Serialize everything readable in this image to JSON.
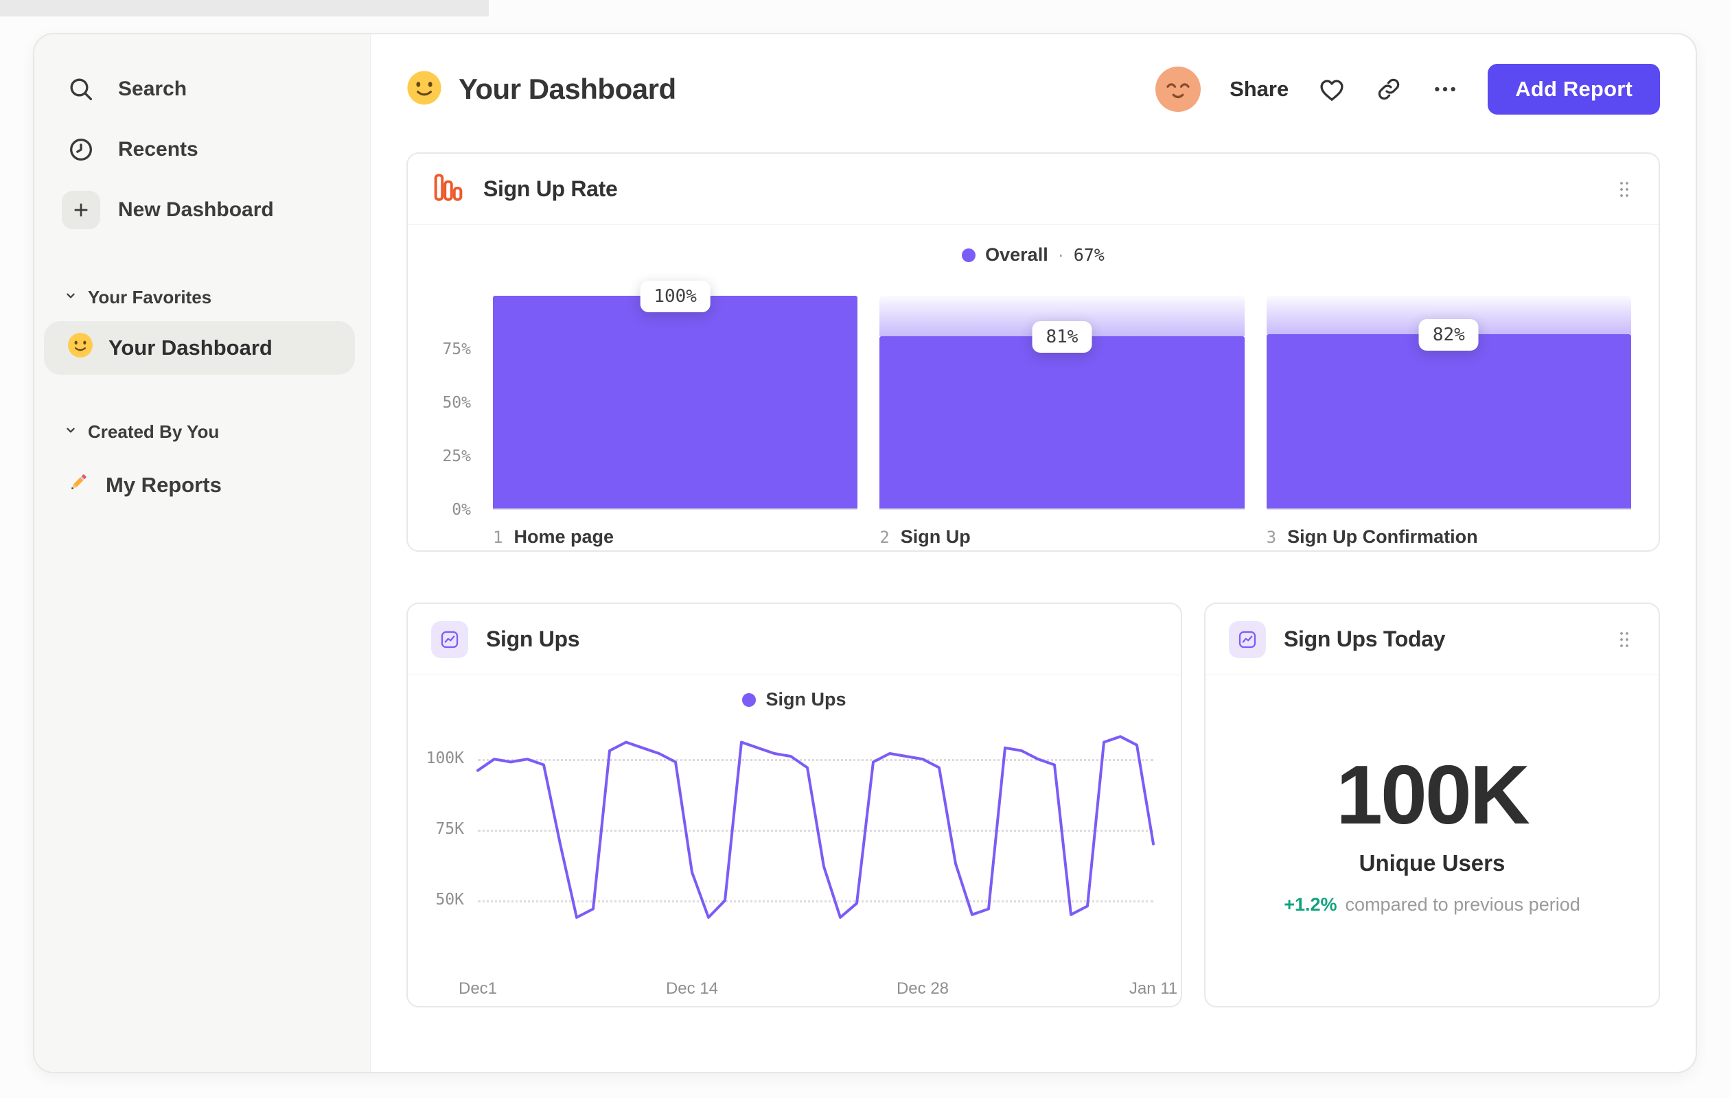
{
  "sidebar": {
    "search": "Search",
    "recents": "Recents",
    "new_dashboard": "New Dashboard",
    "favorites_header": "Your Favorites",
    "favorite_item": "Your Dashboard",
    "created_header": "Created By You",
    "created_item": "My Reports"
  },
  "header": {
    "title": "Your Dashboard",
    "share": "Share",
    "add_report": "Add Report"
  },
  "signup_rate_card": {
    "title": "Sign Up Rate",
    "legend_label": "Overall",
    "legend_separator": "·",
    "legend_value": "67%"
  },
  "signups_card": {
    "title": "Sign Ups",
    "legend_label": "Sign Ups"
  },
  "today_card": {
    "title": "Sign Ups Today",
    "value": "100K",
    "subtitle": "Unique Users",
    "delta": "+1.2%",
    "delta_caption": "compared to previous period"
  },
  "colors": {
    "chart_purple": "#7b5cf6",
    "button_purple": "#5b49f2",
    "icon_orange": "#ed5a2b",
    "positive_green": "#12a380",
    "avatar_peach": "#f4a77d"
  },
  "chart_data": [
    {
      "type": "bar",
      "subtype": "funnel",
      "title": "Sign Up Rate",
      "overall_conversion_pct": 67,
      "categories": [
        "Home page",
        "Sign Up",
        "Sign Up Confirmation"
      ],
      "step_numbers": [
        "1",
        "2",
        "3"
      ],
      "values": [
        100,
        81,
        82
      ],
      "value_labels": [
        "100%",
        "81%",
        "82%"
      ],
      "ylim": [
        0,
        100
      ],
      "y_ticks": [
        {
          "label": "75%",
          "value": 75
        },
        {
          "label": "50%",
          "value": 50
        },
        {
          "label": "25%",
          "value": 25
        },
        {
          "label": "0%",
          "value": 0
        }
      ],
      "bar_color": "#7b5cf6",
      "legend_position": "top-center"
    },
    {
      "type": "line",
      "title": "Sign Ups",
      "units": "thousands",
      "series": [
        {
          "name": "Sign Ups",
          "values": [
            96,
            100,
            99,
            100,
            98,
            70,
            44,
            47,
            103,
            106,
            104,
            102,
            99,
            60,
            44,
            50,
            106,
            104,
            102,
            101,
            97,
            62,
            44,
            49,
            99,
            102,
            101,
            100,
            97,
            63,
            45,
            47,
            104,
            103,
            100,
            98,
            45,
            48,
            106,
            108,
            105,
            70
          ]
        }
      ],
      "x_ticks": [
        {
          "label": "Dec1",
          "index": 0
        },
        {
          "label": "Dec 14",
          "index": 13
        },
        {
          "label": "Dec 28",
          "index": 27
        },
        {
          "label": "Jan 11",
          "index": 41
        }
      ],
      "y_ticks": [
        {
          "label": "100K",
          "value": 100
        },
        {
          "label": "75K",
          "value": 75
        },
        {
          "label": "50K",
          "value": 50
        }
      ],
      "ylim": [
        26,
        110.5
      ],
      "grid": "dotted-horizontal",
      "legend_position": "top-center",
      "line_color": "#7b5cf6"
    }
  ]
}
